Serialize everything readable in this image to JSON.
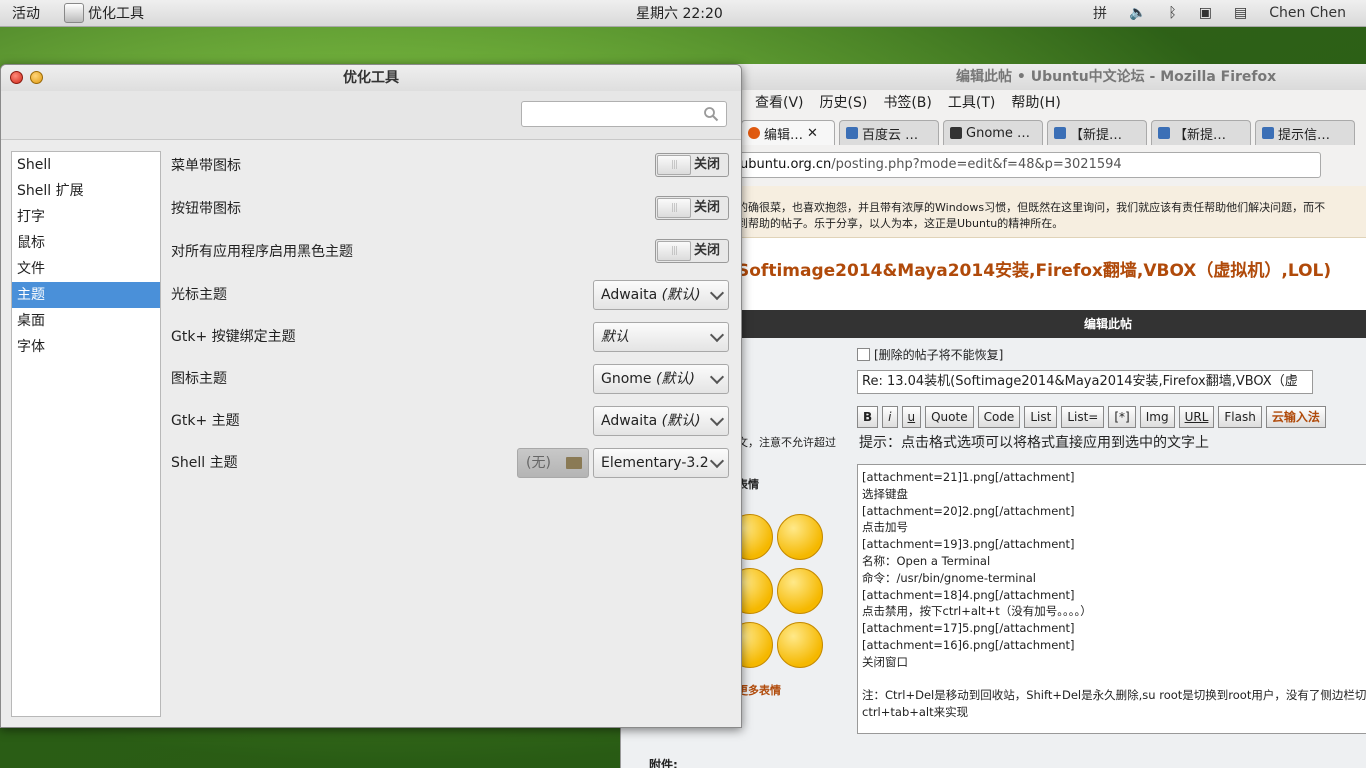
{
  "top_panel": {
    "activities": "活动",
    "app_name": "优化工具",
    "clock": "星期六 22:20",
    "input_method": "拼",
    "user": "Chen Chen"
  },
  "firefox": {
    "title": "编辑此帖 • Ubuntu中文论坛 - Mozilla Firefox",
    "menus": [
      "查看(V)",
      "历史(S)",
      "书签(B)",
      "工具(T)",
      "帮助(H)"
    ],
    "tabs": [
      "编辑…",
      "百度云 …",
      "Gnome …",
      "【新提…",
      "【新提…",
      "提示信…"
    ],
    "url_prefix": "ubuntu.org.cn",
    "url_rest": "/posting.php?mode=edit&f=48&p=3021594",
    "notice_line1": "的确很菜，也喜欢抱怨，并且带有浓厚的Windows习惯，但既然在这里询问，我们就应该有责任帮助他们解决问题，而不",
    "notice_line2": "到帮助的帖子。乐于分享，以人为本，这正是Ubuntu的精神所在。",
    "heading": "Softimage2014&Maya2014安装,Firefox翻墙,VBOX（虚拟机）,LOL)",
    "section_title": "编辑此帖",
    "delete_check": "[删除的帖子将不能恢复]",
    "subject": "Re: 13.04装机(Softimage2014&Maya2014安装,Firefox翻墙,VBOX（虚",
    "format_buttons": [
      "B",
      "i",
      "u",
      "Quote",
      "Code",
      "List",
      "List=",
      "[*]",
      "Img",
      "URL",
      "Flash",
      "云输入法"
    ],
    "format_hint": "提示：点击格式选项可以将格式直接应用到选中的文字上",
    "side_note": "文，注意不允许超过",
    "emoji_label": "表情",
    "more_emoji": "更多表情",
    "post_lines": [
      "[attachment=21]1.png[/attachment]",
      "选择键盘",
      "[attachment=20]2.png[/attachment]",
      "点击加号",
      "[attachment=19]3.png[/attachment]",
      "名称：Open a Terminal",
      "命令：/usr/bin/gnome-terminal",
      "[attachment=18]4.png[/attachment]",
      "点击禁用，按下ctrl+alt+t（没有加号。。。。）",
      "[attachment=17]5.png[/attachment]",
      "[attachment=16]6.png[/attachment]",
      "关闭窗口",
      "",
      "注：Ctrl+Del是移动到回收站，Shift+Del是永久删除,su root是切换到root用户，没有了侧边栏切",
      "ctrl+tab+alt来实现"
    ],
    "attach_label": "附件:"
  },
  "tweak": {
    "title": "优化工具",
    "search_placeholder": "",
    "sidebar": [
      "Shell",
      "Shell 扩展",
      "打字",
      "鼠标",
      "文件",
      "主题",
      "桌面",
      "字体"
    ],
    "selected_index": 5,
    "settings": {
      "menu_icons": {
        "label": "菜单带图标",
        "state": "关闭"
      },
      "button_icons": {
        "label": "按钮带图标",
        "state": "关闭"
      },
      "dark_theme": {
        "label": "对所有应用程序启用黑色主题",
        "state": "关闭"
      },
      "cursor_theme": {
        "label": "光标主题",
        "value": "Adwaita",
        "suffix": "(默认)"
      },
      "keybinding_theme": {
        "label": "Gtk+ 按键绑定主题",
        "value": "",
        "suffix": "默认"
      },
      "icon_theme": {
        "label": "图标主题",
        "value": "Gnome",
        "suffix": "(默认)"
      },
      "gtk_theme": {
        "label": "Gtk+ 主题",
        "value": "Adwaita",
        "suffix": "(默认)"
      },
      "shell_theme": {
        "label": "Shell 主题",
        "file": "(无)",
        "value": "Elementary-3.2",
        "suffix": ""
      }
    }
  }
}
